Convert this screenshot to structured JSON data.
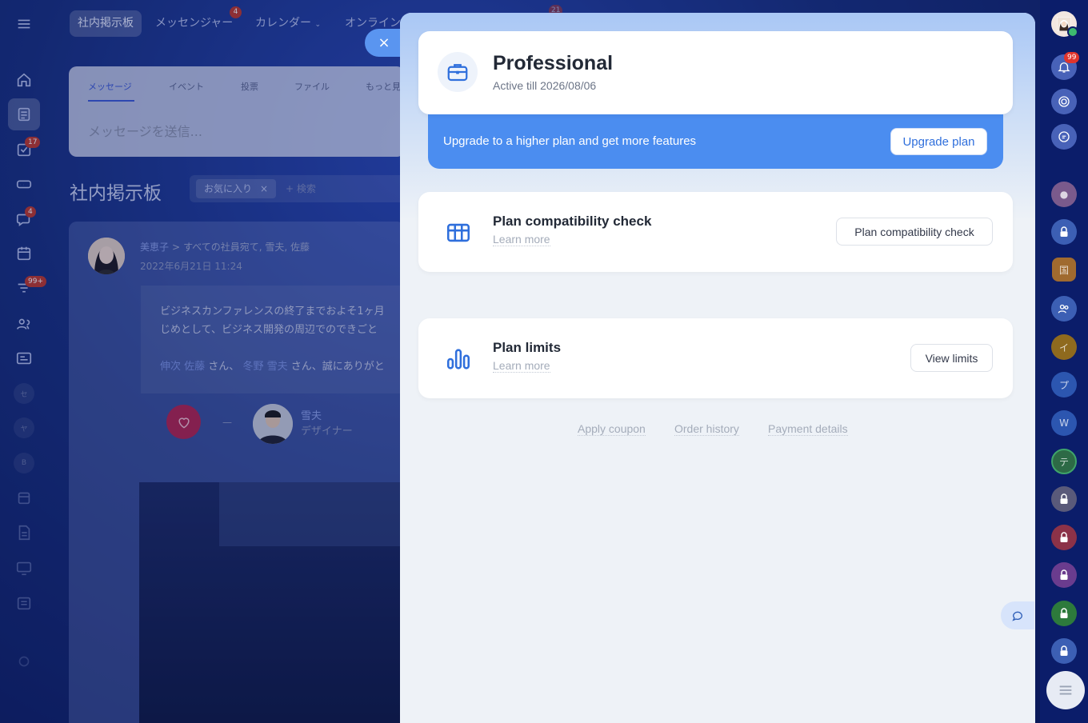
{
  "background": {
    "top_tabs": [
      {
        "label": "社内掲示板",
        "active": true
      },
      {
        "label": "メッセンジャー",
        "badge": "4"
      },
      {
        "label": "カレンダー"
      },
      {
        "label": "オンライン"
      }
    ],
    "top_badge_right": "21",
    "message_box": {
      "tabs": [
        "メッセージ",
        "イベント",
        "投票",
        "ファイル",
        "もっと見"
      ],
      "placeholder": "メッセージを送信..."
    },
    "board_title": "社内掲示板",
    "filter": {
      "chip": "お気に入り",
      "chip_close": "×",
      "search": "+ 検索"
    },
    "left_rail_badges": {
      "tasks": "17",
      "chat": "4",
      "feed": "99+"
    },
    "left_rail_letters": [
      "セ",
      "ヤ",
      "B"
    ],
    "post": {
      "author": "美恵子",
      "recipients": "すべての社員宛て, 雪夫, 佐藤",
      "date": "2022年6月21日 11:24",
      "line1": "ビジネスカンファレンスの終了までおよそ1ヶ月",
      "line2": "じめとして、ビジネス開発の周辺でのできごと",
      "mention1": "伸次 佐藤",
      "mention2": "冬野 雪夫",
      "line3_rest": "さん、誠にありがと",
      "mention_sep": "さん、",
      "user_name": "雪夫",
      "user_role": "デザイナー"
    }
  },
  "right_rail": {
    "bell_badge": "99",
    "letters": [
      "国",
      "イ",
      "プ",
      "W",
      "テ"
    ]
  },
  "panel": {
    "close_label": "×",
    "plan": {
      "name": "Professional",
      "active_till": "Active till 2026/08/06",
      "icon": "briefcase-icon"
    },
    "upgrade": {
      "text": "Upgrade to a higher plan and get more features",
      "button": "Upgrade plan"
    },
    "compatibility": {
      "title": "Plan compatibility check",
      "link": "Learn more",
      "button": "Plan compatibility check",
      "icon": "table-icon"
    },
    "limits": {
      "title": "Plan limits",
      "link": "Learn more",
      "button": "View limits",
      "icon": "bar-chart-icon"
    },
    "footer_links": [
      "Apply coupon",
      "Order history",
      "Payment details"
    ]
  },
  "colors": {
    "accent": "#4b8df0",
    "panel_bg": "#eef2f7",
    "background": "#17307f"
  }
}
